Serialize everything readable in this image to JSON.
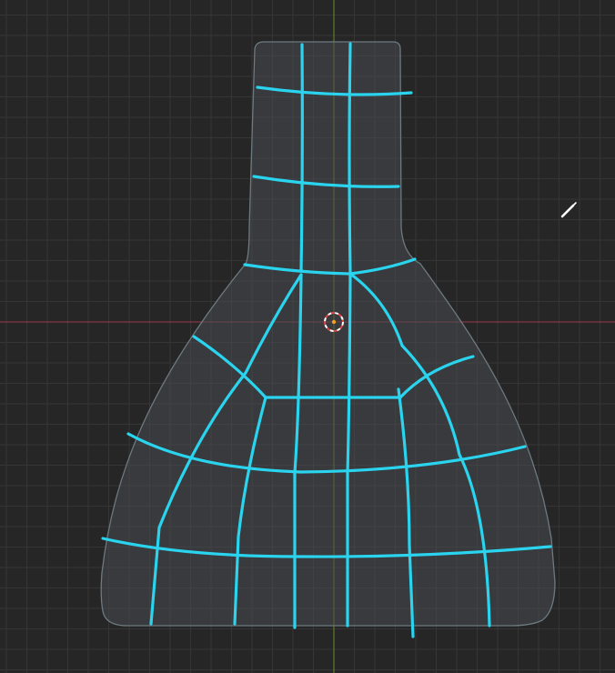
{
  "viewport": {
    "background_color": "#262626",
    "grid_minor_color": "#353535",
    "grid_major_color": "#3c3c3c"
  },
  "axes": {
    "x_axis_color": "#9b3a4a",
    "y_axis_color": "#6f8a26"
  },
  "mesh": {
    "fill_color": "#474b50",
    "fill_opacity": 0.55,
    "outline_color": "#6d7a80"
  },
  "grease_pencil": {
    "stroke_color": "#2ad4ee"
  },
  "cursor_3d": {
    "ring_color_a": "#ffffff",
    "ring_color_b": "#e04848",
    "center_color": "#f0a020"
  },
  "tool_cursor": {
    "icon": "pencil-icon",
    "color": "#ffffff"
  }
}
